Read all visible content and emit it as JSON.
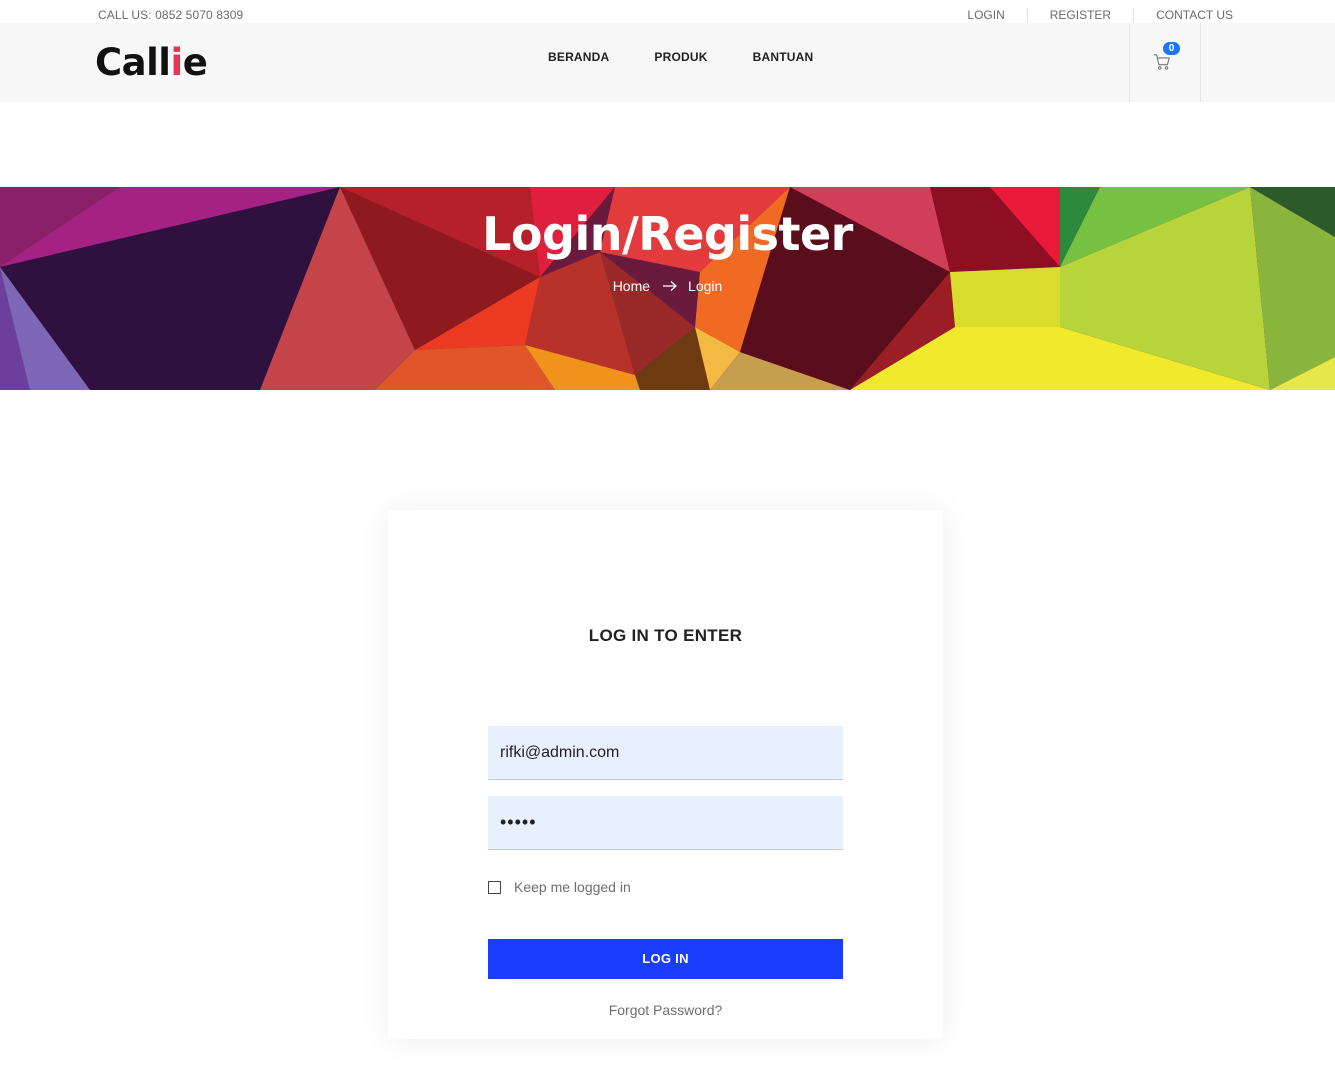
{
  "topbar": {
    "call": "CALL US: 0852 5070 8309",
    "links": [
      "LOGIN",
      "REGISTER",
      "CONTACT US"
    ]
  },
  "header": {
    "logo_main": "Call",
    "logo_accent": "i",
    "logo_end": "e",
    "nav": [
      "BERANDA",
      "PRODUK",
      "BANTUAN"
    ],
    "cart_count": "0",
    "cart_icon": "shopping-cart-icon"
  },
  "banner": {
    "title": "Login/Register",
    "breadcrumb_home": "Home",
    "breadcrumb_current": "Login",
    "separator_icon": "arrow-right-icon"
  },
  "login": {
    "heading": "LOG IN TO ENTER",
    "email_value": "rifki@admin.com",
    "password_value": "•••••",
    "remember_label": "Keep me logged in",
    "remember_checked": false,
    "button_label": "LOG IN",
    "forgot_label": "Forgot Password?"
  },
  "colors": {
    "accent": "#e8345a",
    "button": "#1a3dff",
    "badge": "#1e73ff",
    "input_bg": "#e8f0fe"
  }
}
